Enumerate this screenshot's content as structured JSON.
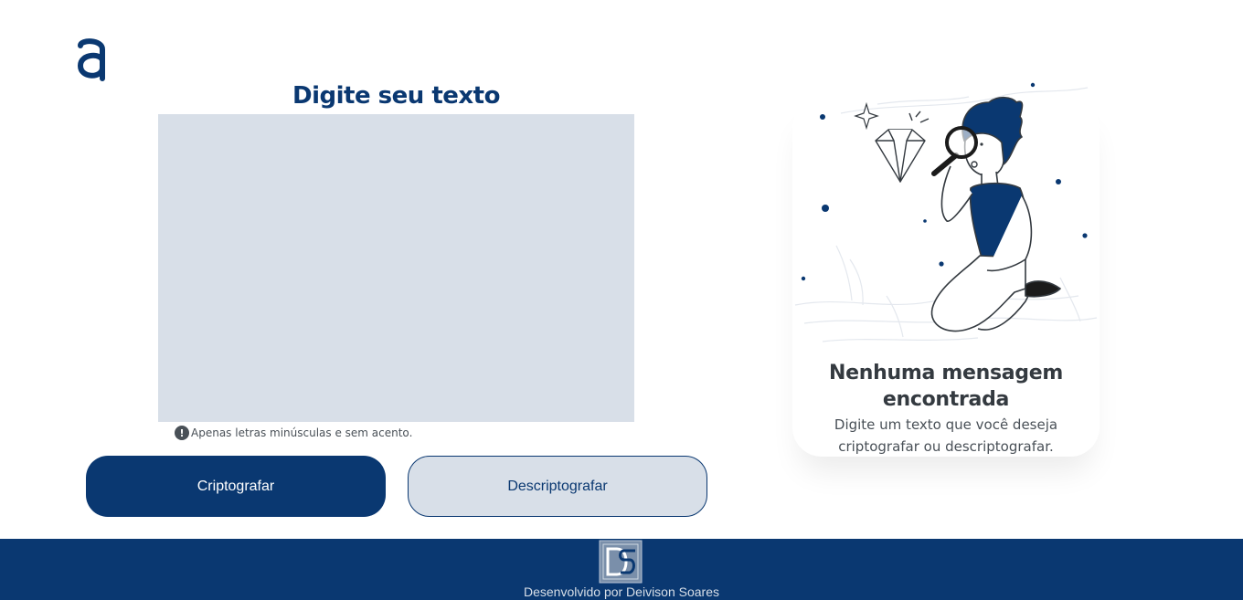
{
  "header": {
    "logo_icon": "alura-a-logo-icon"
  },
  "input_section": {
    "title": "Digite seu texto",
    "input_value": "",
    "input_placeholder": "",
    "hint_icon": "exclamation-circle-icon",
    "hint_text": "Apenas letras minúsculas e sem acento."
  },
  "buttons": {
    "encrypt_label": "Criptografar",
    "decrypt_label": "Descriptografar"
  },
  "output_card": {
    "illustration": "person-with-magnifying-glass-and-diamond-illustration",
    "title": "Nenhuma mensagem encontrada",
    "text": "Digite um texto que você deseja criptografar ou descriptografar."
  },
  "footer": {
    "logo_icon": "ds-monogram-logo",
    "credit": "Desenvolvido por Deivison Soares"
  },
  "colors": {
    "primary": "#0a3871",
    "input_background": "#d8dfe8",
    "heading_dark": "#343a40",
    "body_text": "#495057"
  }
}
